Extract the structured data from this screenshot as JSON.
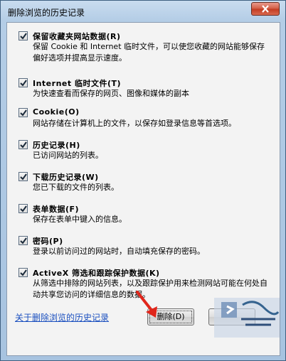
{
  "window": {
    "title": "删除浏览的历史记录"
  },
  "options": [
    {
      "title": "保留收藏夹网站数据(R)",
      "desc": "保留 Cookie 和 Internet 临时文件，可以使您收藏的网站能够保存偏好选项并提高显示速度。",
      "checked": true
    },
    {
      "title": "Internet 临时文件(T)",
      "desc": "为快速查看而保存的网页、图像和媒体的副本",
      "checked": true
    },
    {
      "title": "Cookie(O)",
      "desc": "网站存储在计算机上的文件，以保存如登录信息等首选项。",
      "checked": true
    },
    {
      "title": "历史记录(H)",
      "desc": "已访问网站的列表。",
      "checked": true
    },
    {
      "title": "下载历史记录(W)",
      "desc": "您已下载的文件的列表。",
      "checked": true
    },
    {
      "title": "表单数据(F)",
      "desc": "保存在表单中键入的信息。",
      "checked": true
    },
    {
      "title": "密码(P)",
      "desc": "登录以前访问过的网站时，自动填充保存的密码。",
      "checked": true
    },
    {
      "title": "ActiveX 筛选和跟踪保护数据(K)",
      "desc": "从筛选中排除的网站列表，以及跟踪保护用来检测网站可能在何处自动共享您访问的详细信息的数据。",
      "checked": true
    }
  ],
  "footer": {
    "link": "关于删除浏览的历史记录",
    "delete_label": "删除(D)",
    "cancel_label": ""
  },
  "colors": {
    "link": "#1a4fbf",
    "arrow": "#e0261b",
    "close": "#c23a20"
  }
}
